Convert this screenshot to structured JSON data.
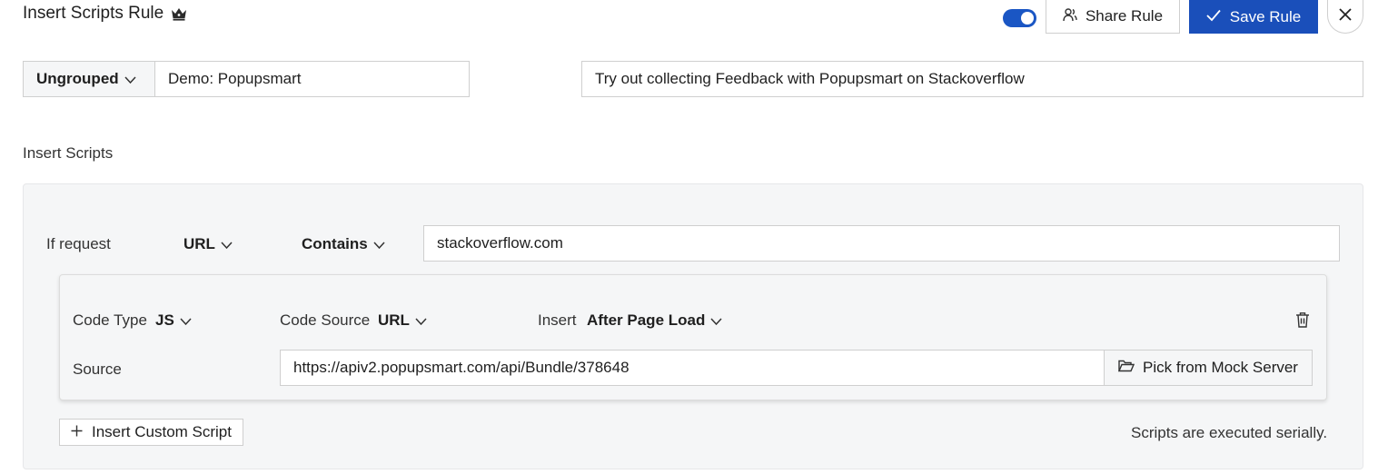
{
  "header": {
    "title": "Insert Scripts Rule",
    "toggle_on": true,
    "share_label": "Share Rule",
    "save_label": "Save Rule",
    "icons": {
      "premium": "crown-icon",
      "share": "share-people-icon",
      "save": "check-icon",
      "close": "close-icon"
    }
  },
  "rule": {
    "group": "Ungrouped",
    "name": "Demo: Popupsmart",
    "description": "Try out collecting Feedback with Popupsmart on Stackoverflow"
  },
  "section": {
    "label": "Insert Scripts"
  },
  "condition": {
    "label": "If request",
    "key": "URL",
    "operator": "Contains",
    "value": "stackoverflow.com"
  },
  "script": {
    "code_type_label": "Code Type",
    "code_type": "JS",
    "code_source_label": "Code Source",
    "code_source": "URL",
    "insert_label": "Insert",
    "insert_when": "After Page Load",
    "source_label": "Source",
    "source_value": "https://apiv2.popupsmart.com/api/Bundle/378648",
    "mock_label": "Pick from Mock Server"
  },
  "footer": {
    "add_label": "Insert Custom Script",
    "note": "Scripts are executed serially."
  },
  "colors": {
    "primary": "#1a4fba",
    "toggle": "#1a56c4",
    "panel_bg": "#f5f6f7",
    "border": "#cfcfcf"
  }
}
